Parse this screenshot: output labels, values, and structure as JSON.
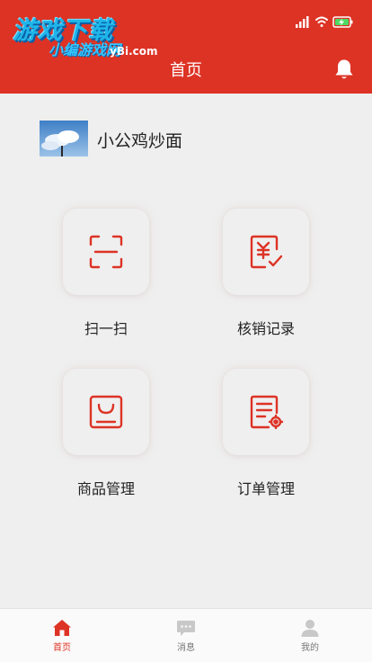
{
  "watermark": {
    "line1": "游戏下载",
    "line2": "小编游戏网",
    "line3": "yBi.com"
  },
  "header": {
    "title": "首页",
    "bell_icon": "bell-icon"
  },
  "status_bar": {
    "icons": [
      "signal-icon",
      "wifi-icon",
      "battery-charging-icon"
    ]
  },
  "store": {
    "name": "小公鸡炒面",
    "avatar_icon": "store-avatar-sky-photo"
  },
  "actions": [
    {
      "label": "扫一扫",
      "icon": "scan-icon"
    },
    {
      "label": "核销记录",
      "icon": "verification-record-icon"
    },
    {
      "label": "商品管理",
      "icon": "product-management-icon"
    },
    {
      "label": "订单管理",
      "icon": "order-management-icon"
    }
  ],
  "tabbar": {
    "items": [
      {
        "label": "首页",
        "icon": "home-icon",
        "active": true
      },
      {
        "label": "消息",
        "icon": "message-icon",
        "active": false
      },
      {
        "label": "我的",
        "icon": "user-icon",
        "active": false
      }
    ]
  },
  "colors": {
    "primary": "#dd3325",
    "background": "#efefef",
    "tab_inactive": "#c8c8c8"
  }
}
